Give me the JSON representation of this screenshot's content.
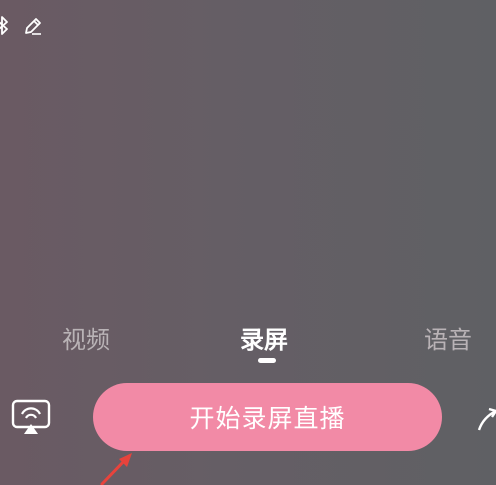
{
  "top_icons": [
    {
      "name": "bluetooth-icon"
    },
    {
      "name": "edit-icon"
    }
  ],
  "mode_tabs": {
    "items": [
      {
        "label": "视频"
      },
      {
        "label": "录屏"
      },
      {
        "label": "语音"
      }
    ],
    "selected": "录屏"
  },
  "primary_action": {
    "label": "开始录屏直播"
  },
  "colors": {
    "primary_button": "#f28aa6",
    "tab_active": "#ffffff",
    "tab_inactive": "#b9b3b6",
    "annotation_arrow": "#e8433c"
  },
  "icons": [
    "cast-screen-icon",
    "share-icon",
    "annotation-arrow"
  ]
}
